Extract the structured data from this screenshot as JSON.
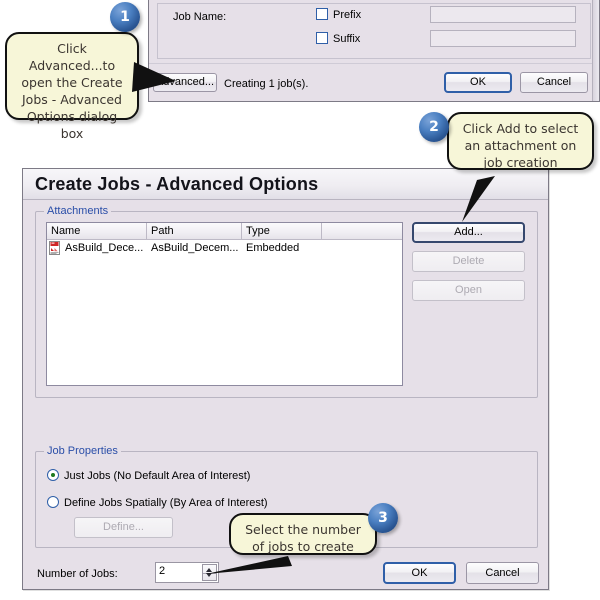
{
  "background": {
    "color": "#ffffff"
  },
  "colors": {
    "dialog_face": "#e6e0e8",
    "group_title": "#2a4ea8",
    "callout_fill": "#f7f6d8",
    "callout_border": "#111111",
    "badge_blue": "#2b5795",
    "accent_default_button": "#2f5fa8"
  },
  "top_dialog": {
    "name": "create-jobs-dialog-partial",
    "job_name_label": "Job Name:",
    "prefix_checkbox": {
      "label": "Prefix",
      "checked": false,
      "value": "",
      "placeholder": ""
    },
    "suffix_checkbox": {
      "label": "Suffix",
      "checked": false,
      "value": "",
      "placeholder": ""
    },
    "advanced_button": "Advanced...",
    "status_text": "Creating 1 job(s).",
    "ok_button": "OK",
    "cancel_button": "Cancel"
  },
  "main_dialog": {
    "title": "Create Jobs - Advanced Options",
    "attachments": {
      "group_label": "Attachments",
      "columns": [
        "Name",
        "Path",
        "Type",
        ""
      ],
      "rows": [
        {
          "icon": "pdf-document-icon",
          "name": "AsBuild_Dece...",
          "path": "AsBuild_Decem...",
          "type": "Embedded"
        }
      ],
      "buttons": [
        {
          "label": "Add...",
          "state": "enabled",
          "name": "add-attachment-button"
        },
        {
          "label": "Delete",
          "state": "disabled",
          "name": "delete-attachment-button"
        },
        {
          "label": "Open",
          "state": "disabled",
          "name": "open-attachment-button"
        }
      ]
    },
    "job_properties": {
      "group_label": "Job Properties",
      "options": [
        {
          "label": "Just Jobs (No Default Area of Interest)",
          "selected": true
        },
        {
          "label": "Define Jobs Spatially (By Area of Interest)",
          "selected": false
        }
      ],
      "define_button": {
        "label": "Define...",
        "state": "disabled"
      }
    },
    "number_of_jobs": {
      "label": "Number of Jobs:",
      "value": "2",
      "spinner_up": "spinner-up-icon",
      "spinner_down": "spinner-down-icon"
    },
    "ok_button": "OK",
    "cancel_button": "Cancel"
  },
  "callouts": [
    {
      "number": "1",
      "text": "Click Advanced...to open the Create Jobs - Advanced Options dialog box"
    },
    {
      "number": "2",
      "text": "Click Add to select an attachment on job creation"
    },
    {
      "number": "3",
      "text": "Select the number of jobs to create"
    }
  ]
}
